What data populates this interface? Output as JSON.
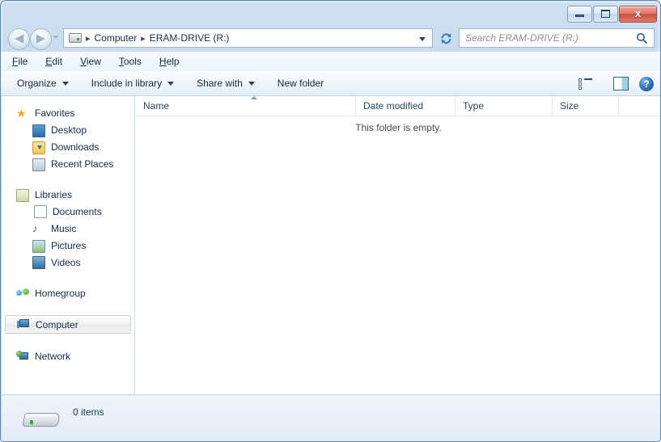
{
  "window": {
    "titlebar": {
      "minimize_label": "Minimize",
      "maximize_label": "Maximize",
      "close_label": "x"
    }
  },
  "address": {
    "back_arrow": "◀",
    "forward_arrow": "▶",
    "breadcrumb": [
      {
        "label": "Computer"
      },
      {
        "label": "ERAM-DRIVE (R:)"
      }
    ],
    "separator": "▸",
    "drive_icon": "removable-drive-icon"
  },
  "search": {
    "placeholder": "Search ERAM-DRIVE (R:)"
  },
  "menu": {
    "items": [
      {
        "access": "F",
        "rest": "ile"
      },
      {
        "access": "E",
        "rest": "dit"
      },
      {
        "access": "V",
        "rest": "iew"
      },
      {
        "access": "T",
        "rest": "ools"
      },
      {
        "access": "H",
        "rest": "elp"
      }
    ]
  },
  "toolbar": {
    "organize_label": "Organize",
    "include_label": "Include in library",
    "share_label": "Share with",
    "newfolder_label": "New folder",
    "help_glyph": "?"
  },
  "sidebar": {
    "groups": [
      {
        "header": {
          "label": "Favorites",
          "icon": "star-icon"
        },
        "items": [
          {
            "label": "Desktop",
            "icon": "desktop-icon"
          },
          {
            "label": "Downloads",
            "icon": "downloads-folder-icon"
          },
          {
            "label": "Recent Places",
            "icon": "recent-places-icon"
          }
        ]
      },
      {
        "header": {
          "label": "Libraries",
          "icon": "libraries-icon"
        },
        "items": [
          {
            "label": "Documents",
            "icon": "document-icon"
          },
          {
            "label": "Music",
            "icon": "music-note-icon"
          },
          {
            "label": "Pictures",
            "icon": "picture-icon"
          },
          {
            "label": "Videos",
            "icon": "video-icon"
          }
        ]
      },
      {
        "header": {
          "label": "Homegroup",
          "icon": "homegroup-icon"
        },
        "items": []
      },
      {
        "header": {
          "label": "Computer",
          "icon": "computer-icon",
          "selected": true
        },
        "items": []
      },
      {
        "header": {
          "label": "Network",
          "icon": "network-icon"
        },
        "items": []
      }
    ]
  },
  "content": {
    "columns": [
      {
        "label": "Name"
      },
      {
        "label": "Date modified"
      },
      {
        "label": "Type"
      },
      {
        "label": "Size"
      }
    ],
    "sort_column": "Name",
    "sort_direction": "ascending",
    "empty_message": "This folder is empty."
  },
  "statusbar": {
    "item_count": "0 items",
    "drive_icon": "removable-drive-icon"
  }
}
